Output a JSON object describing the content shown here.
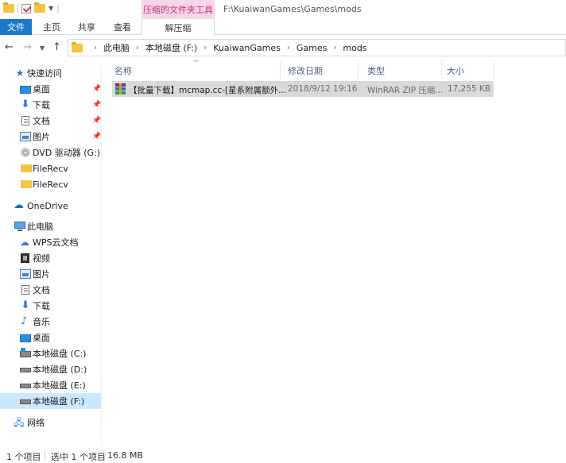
{
  "titlebar": {
    "context_tab_header": "压缩的文件夹工具",
    "path": "F:\\KuaiwanGames\\Games\\mods"
  },
  "ribbon": {
    "tabs": [
      "文件",
      "主页",
      "共享",
      "查看"
    ],
    "context_tab": "解压缩",
    "file_tab_color": "#1979ca",
    "context_color": "#f7d6e8"
  },
  "address": {
    "crumbs": [
      "此电脑",
      "本地磁盘 (F:)",
      "KuaiwanGames",
      "Games",
      "mods"
    ]
  },
  "sidebar": {
    "items": [
      {
        "label": "快速访问",
        "icon": "star-icon"
      },
      {
        "label": "桌面",
        "icon": "desktop-icon",
        "pinned": true
      },
      {
        "label": "下载",
        "icon": "download-icon",
        "pinned": true
      },
      {
        "label": "文档",
        "icon": "document-icon",
        "pinned": true
      },
      {
        "label": "图片",
        "icon": "pictures-icon",
        "pinned": true
      },
      {
        "label": "DVD 驱动器 (G:)",
        "icon": "dvd-icon"
      },
      {
        "label": "FileRecv",
        "icon": "folder-icon"
      },
      {
        "label": "FileRecv",
        "icon": "folder-icon"
      },
      {
        "label": "OneDrive",
        "icon": "cloud-icon"
      },
      {
        "label": "此电脑",
        "icon": "computer-icon"
      },
      {
        "label": "WPS云文档",
        "icon": "wps-cloud-icon"
      },
      {
        "label": "视频",
        "icon": "video-icon"
      },
      {
        "label": "图片",
        "icon": "pictures-icon"
      },
      {
        "label": "文档",
        "icon": "document-icon"
      },
      {
        "label": "下载",
        "icon": "download-icon"
      },
      {
        "label": "音乐",
        "icon": "music-icon"
      },
      {
        "label": "桌面",
        "icon": "desktop-icon"
      },
      {
        "label": "本地磁盘 (C:)",
        "icon": "drive-icon"
      },
      {
        "label": "本地磁盘 (D:)",
        "icon": "drive-icon"
      },
      {
        "label": "本地磁盘 (E:)",
        "icon": "drive-icon"
      },
      {
        "label": "本地磁盘 (F:)",
        "icon": "drive-icon",
        "selected": true
      },
      {
        "label": "网络",
        "icon": "network-icon"
      }
    ]
  },
  "columns": {
    "name": "名称",
    "date": "修改日期",
    "type": "类型",
    "size": "大小"
  },
  "files": [
    {
      "name": "【批量下载】mcmap.cc-[星系附属额外...",
      "date": "2018/9/12 19:16",
      "type": "WinRAR ZIP 压缩...",
      "size": "17,255 KB"
    }
  ],
  "status": {
    "count": "1 个项目",
    "selected": "选中 1 个项目",
    "size": "16.8 MB"
  }
}
